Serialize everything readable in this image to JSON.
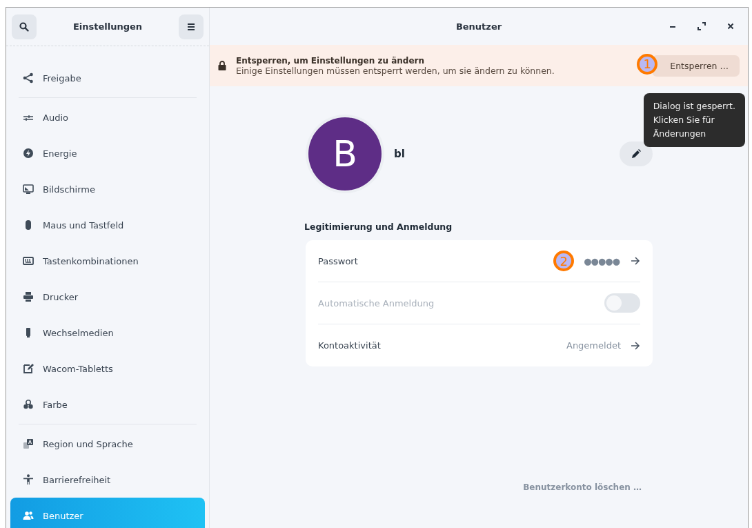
{
  "sidebar": {
    "title": "Einstellungen",
    "groups": [
      [
        {
          "label": "Freigabe",
          "selected": false
        }
      ],
      [
        {
          "label": "Audio",
          "selected": false
        },
        {
          "label": "Energie",
          "selected": false
        },
        {
          "label": "Bildschirme",
          "selected": false
        },
        {
          "label": "Maus und Tastfeld",
          "selected": false
        },
        {
          "label": "Tastenkombinationen",
          "selected": false
        },
        {
          "label": "Drucker",
          "selected": false
        },
        {
          "label": "Wechselmedien",
          "selected": false
        },
        {
          "label": "Wacom-Tabletts",
          "selected": false
        },
        {
          "label": "Farbe",
          "selected": false
        }
      ],
      [
        {
          "label": "Region und Sprache",
          "selected": false
        },
        {
          "label": "Barrierefreiheit",
          "selected": false
        },
        {
          "label": "Benutzer",
          "selected": true
        }
      ]
    ]
  },
  "window": {
    "title": "Benutzer"
  },
  "banner": {
    "title": "Entsperren, um Einstellungen zu ändern",
    "text": "Einige Einstellungen müssen entsperrt werden, um sie ändern zu können.",
    "button": "Entsperren …",
    "marker": "1"
  },
  "tooltip": {
    "lines": [
      "Dialog ist gesperrt.",
      "Klicken Sie für",
      "Änderungen"
    ]
  },
  "user": {
    "initial": "B",
    "name": "bl"
  },
  "section": {
    "title": "Legitimierung und Anmeldung",
    "rows": [
      {
        "kind": "password",
        "label": "Passwort",
        "value": "●●●●●",
        "marker": "2",
        "disabled": false
      },
      {
        "kind": "switch",
        "label": "Automatische Anmeldung",
        "on": false,
        "disabled": true
      },
      {
        "kind": "link",
        "label": "Kontoaktivität",
        "value": "Angemeldet",
        "disabled": false
      }
    ]
  },
  "delete_link": "Benutzerkonto löschen …"
}
